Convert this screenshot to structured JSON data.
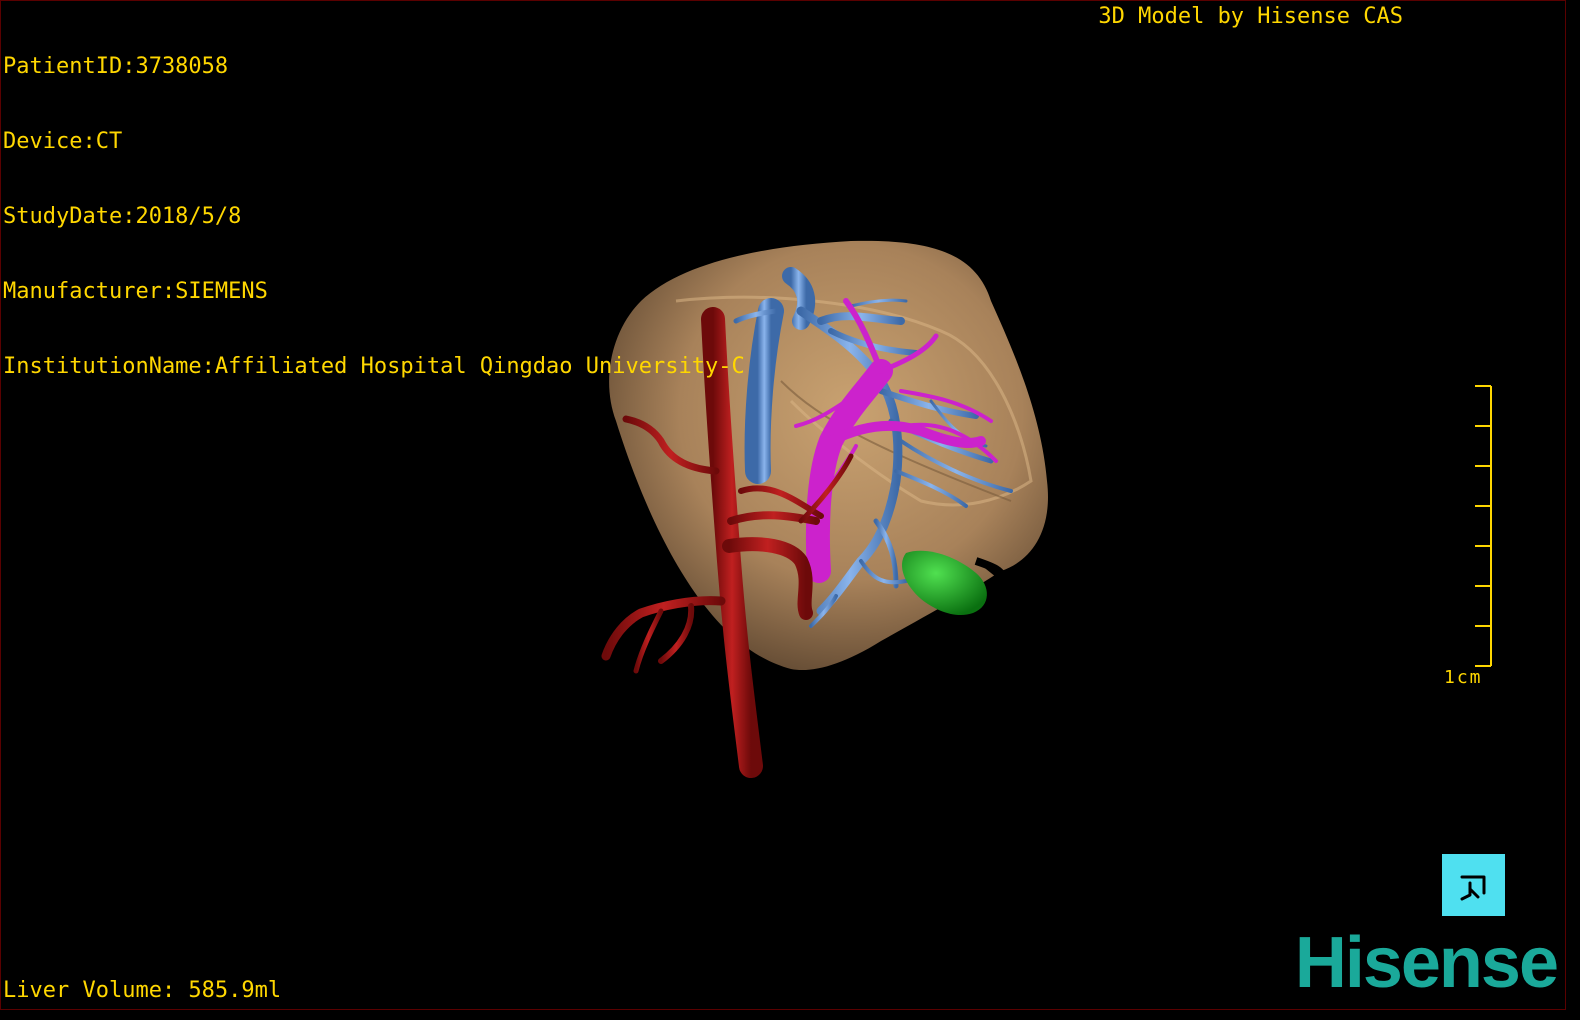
{
  "patient_info": {
    "patient_id": "PatientID:3738058",
    "device": "Device:CT",
    "study_date": "StudyDate:2018/5/8",
    "manufacturer": "Manufacturer:SIEMENS",
    "institution": "InstitutionName:Affiliated Hospital Qingdao University-C"
  },
  "credit": "3D Model by Hisense CAS",
  "volume": "Liver Volume: 585.9ml",
  "scale": {
    "label": "1cm"
  },
  "orientation_button": {
    "icon": "orientation-cube-icon"
  },
  "logo": "Hisense",
  "colors": {
    "text": "#ffd700",
    "liver": "#b08a5a",
    "artery": "#b01818",
    "vein": "#6a9ad8",
    "portal": "#d020d0",
    "gallbladder": "#10a020",
    "logo": "#1aa99a"
  }
}
